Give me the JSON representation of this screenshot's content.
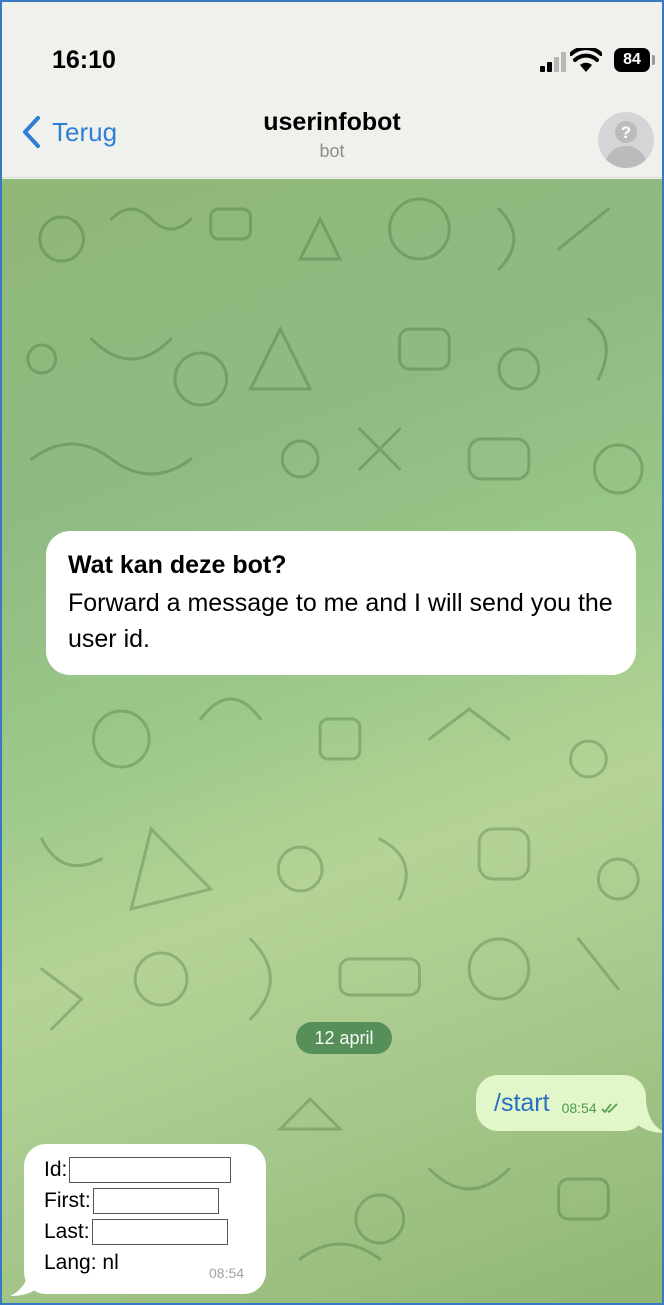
{
  "status_bar": {
    "time": "16:10",
    "battery": "84"
  },
  "nav": {
    "back_label": "Terug",
    "title": "userinfobot",
    "subtitle": "bot",
    "avatar_icon": "unknown-user-icon"
  },
  "intro_card": {
    "title": "Wat kan deze bot?",
    "text": "Forward a message to me and I will send you the user id."
  },
  "date_separator": "12 april",
  "messages": [
    {
      "direction": "outgoing",
      "text": "/start",
      "time": "08:54",
      "status": "read"
    },
    {
      "direction": "incoming",
      "lines": [
        {
          "label": "Id:",
          "value": ""
        },
        {
          "label": "First:",
          "value": ""
        },
        {
          "label": "Last:",
          "value": ""
        },
        {
          "label": "Lang: nl",
          "value": null
        }
      ],
      "time": "08:54"
    }
  ],
  "colors": {
    "accent": "#2f7fd6",
    "outgoing_bubble": "#e1f6c9",
    "date_pill": "#4f8a55",
    "frame_border": "#3a78c4"
  }
}
